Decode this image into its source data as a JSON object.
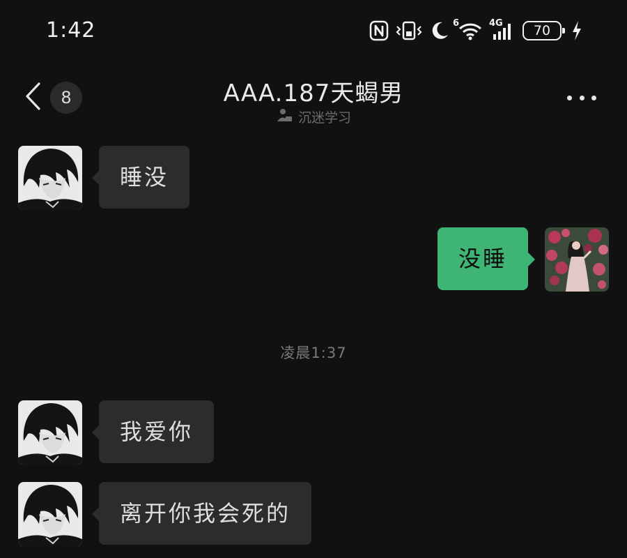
{
  "status_bar": {
    "time": "1:42",
    "network_badge": "6",
    "network_type": "4G",
    "battery": "70"
  },
  "header": {
    "unread_count": "8",
    "title": "AAA.187天蝎男",
    "status_text": "沉迷学习"
  },
  "messages": [
    {
      "side": "left",
      "text": "睡没"
    },
    {
      "side": "right",
      "text": "没睡"
    },
    {
      "side": "left",
      "text": "我爱你"
    },
    {
      "side": "left",
      "text": "离开你我会死的"
    }
  ],
  "timestamp": "凌晨1:37",
  "colors": {
    "background": "#111111",
    "incoming_bubble": "#2c2c2c",
    "outgoing_bubble": "#3eb575"
  },
  "icons": {
    "status_bar": [
      "nfc-icon",
      "vibrate-icon",
      "do-not-disturb-moon-icon",
      "wifi-icon",
      "cellular-signal-icon",
      "battery-icon",
      "charging-bolt-icon"
    ],
    "header": [
      "back-chevron-icon",
      "more-dots-icon",
      "reading-status-icon"
    ]
  }
}
